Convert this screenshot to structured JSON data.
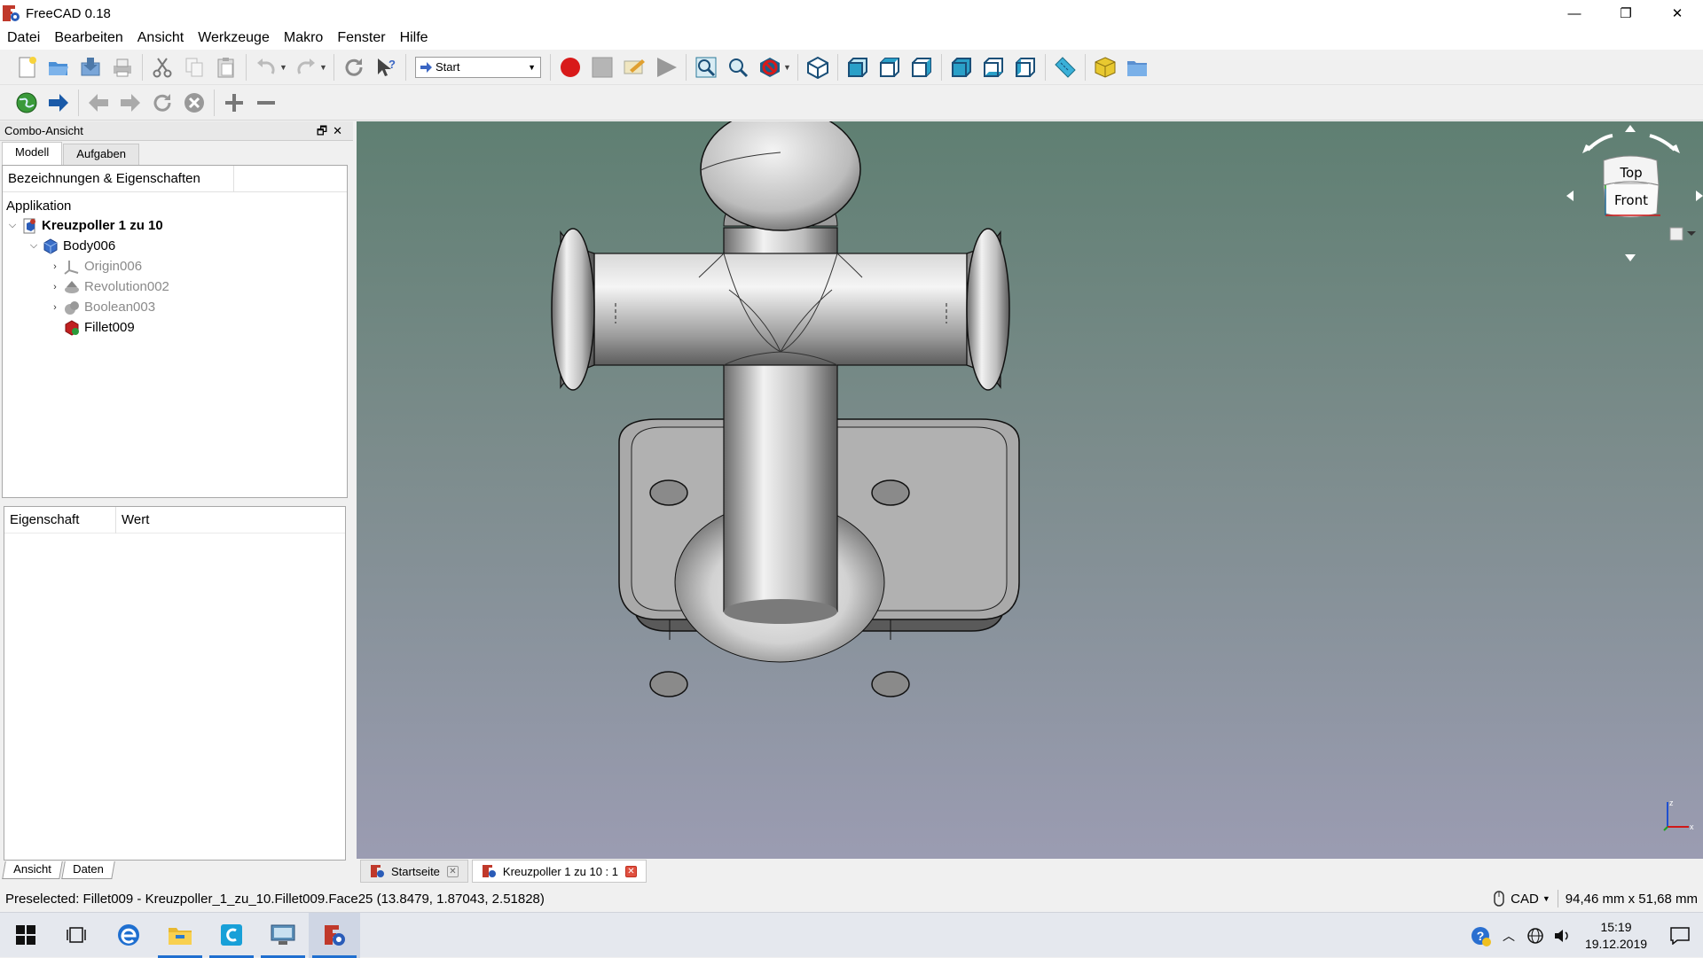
{
  "window": {
    "title": "FreeCAD 0.18",
    "minimize": "—",
    "restore": "❐",
    "close": "✕"
  },
  "menu": [
    "Datei",
    "Bearbeiten",
    "Ansicht",
    "Werkzeuge",
    "Makro",
    "Fenster",
    "Hilfe"
  ],
  "toolbar": {
    "workbench": "Start"
  },
  "combo": {
    "title": "Combo-Ansicht",
    "tabs": [
      "Modell",
      "Aufgaben"
    ],
    "tree_header": "Bezeichnungen & Eigenschaften",
    "section": "Applikation",
    "document": "Kreuzpoller 1 zu 10",
    "body": "Body006",
    "children": [
      "Origin006",
      "Revolution002",
      "Boolean003"
    ],
    "tip": "Fillet009",
    "prop_cols": [
      "Eigenschaft",
      "Wert"
    ],
    "bottom_tabs": [
      "Ansicht",
      "Daten"
    ]
  },
  "navcube": {
    "top": "Top",
    "front": "Front"
  },
  "doc_tabs": [
    "Startseite",
    "Kreuzpoller 1 zu 10 : 1"
  ],
  "status": {
    "message": "Preselected: Fillet009 - Kreuzpoller_1_zu_10.Fillet009.Face25 (13.8479, 1.87043, 2.51828)",
    "nav_style": "CAD",
    "dimensions": "94,46 mm x 51,68 mm"
  },
  "taskbar": {
    "time": "15:19",
    "date": "19.12.2019"
  }
}
